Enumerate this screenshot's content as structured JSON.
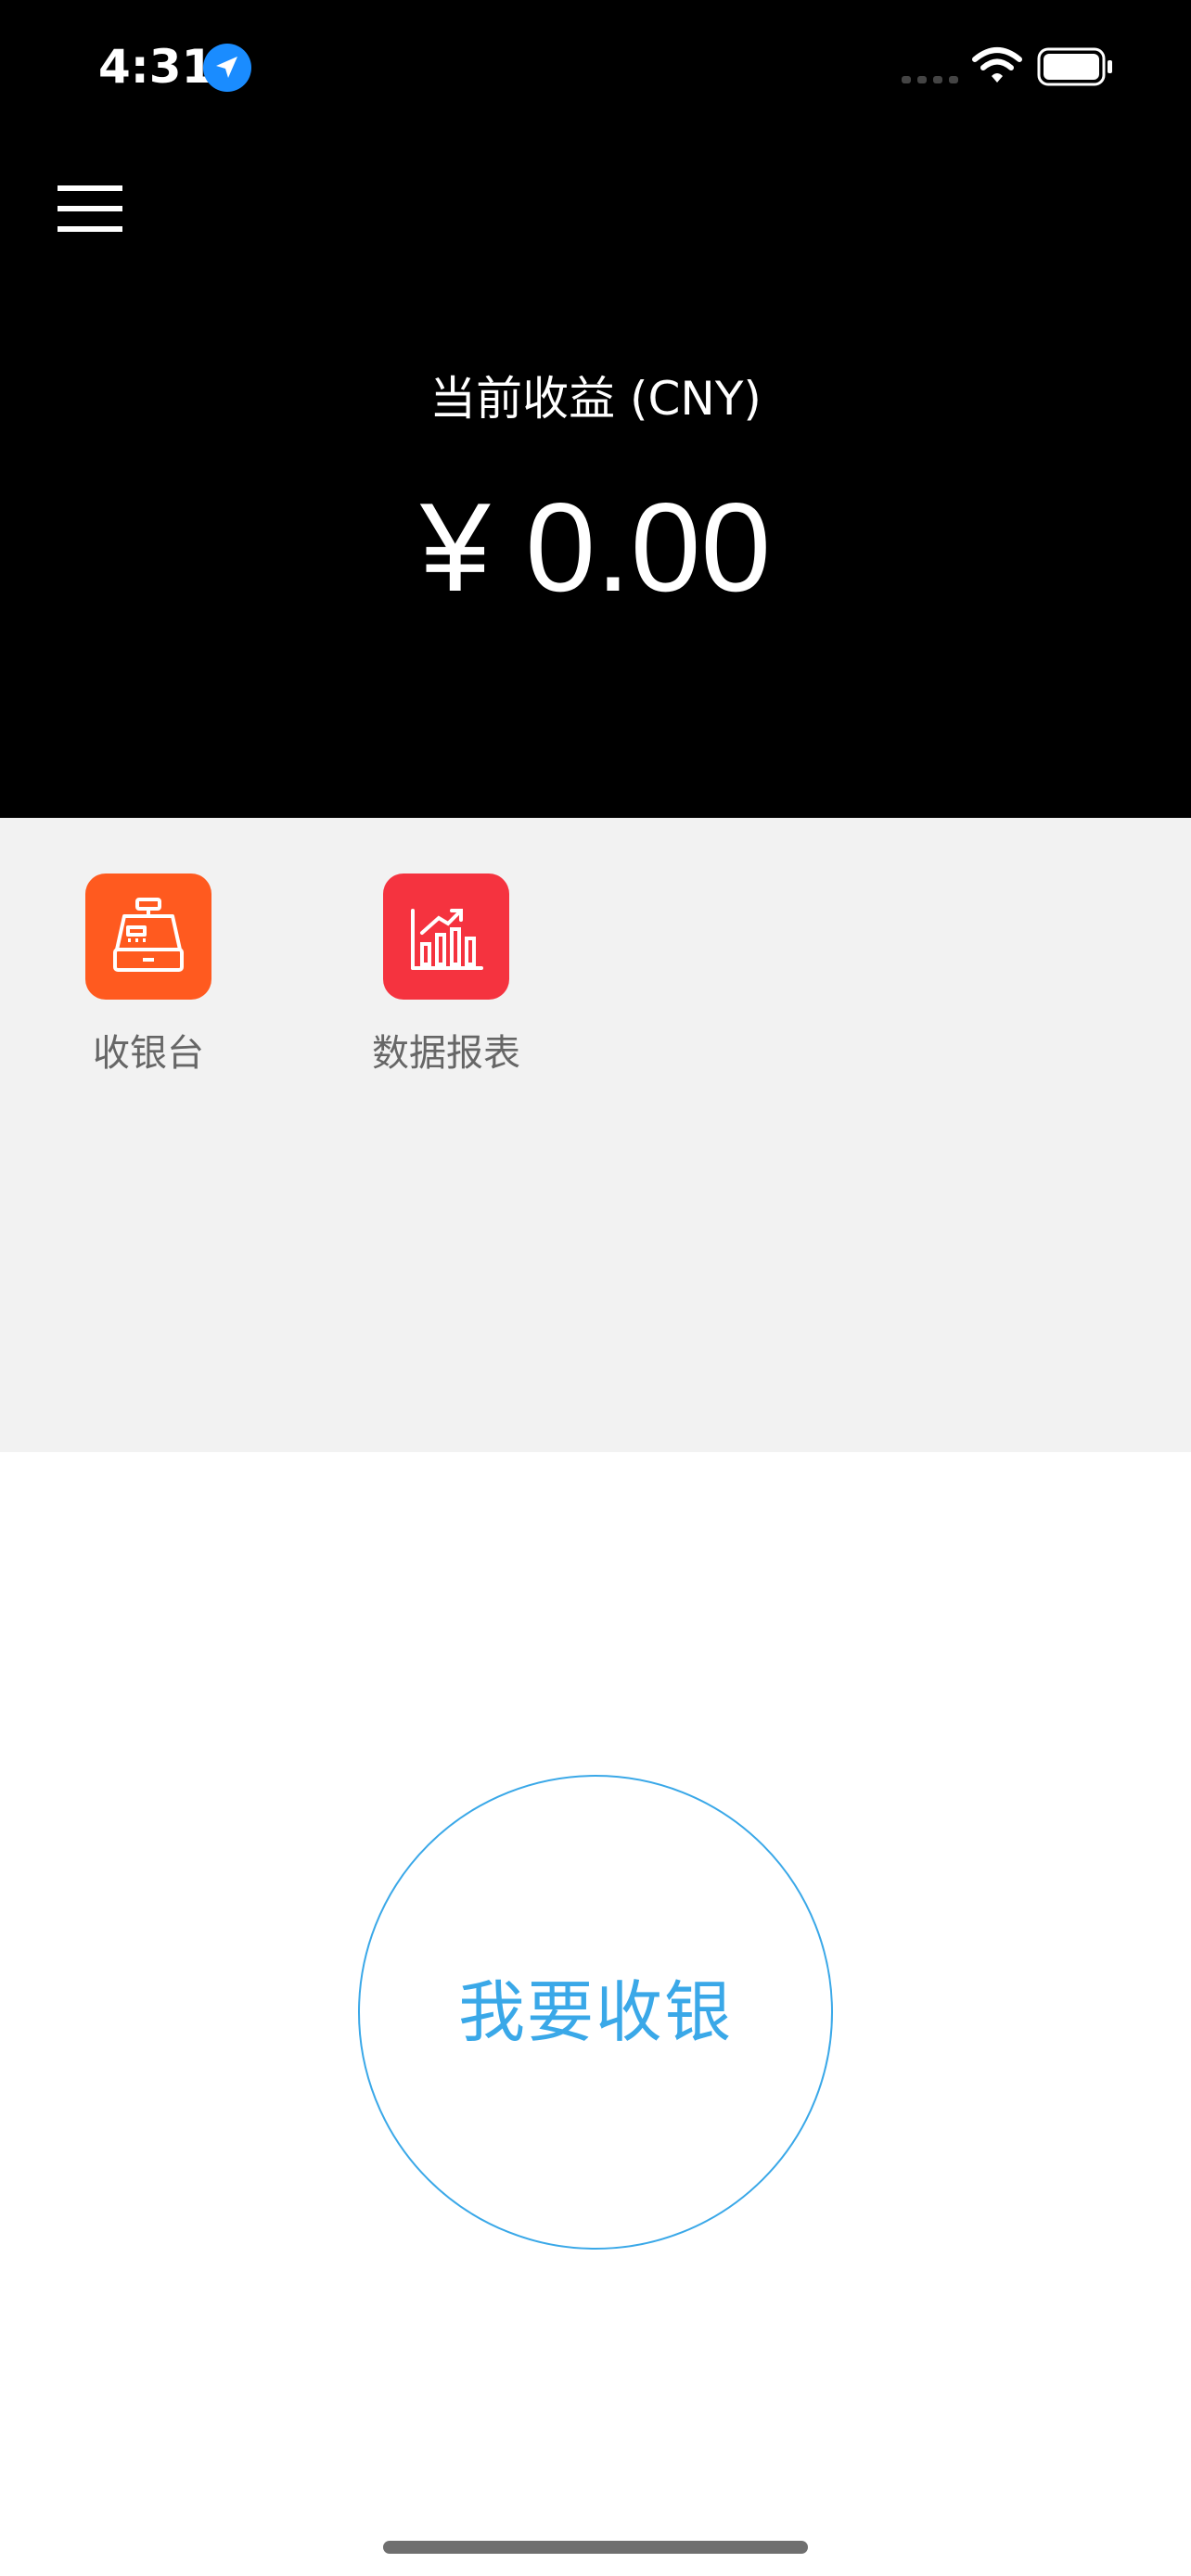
{
  "status_bar": {
    "time": "4:31",
    "icons": [
      "location-arrow-icon",
      "cellular-signal-icon",
      "wifi-icon",
      "battery-icon"
    ]
  },
  "header": {
    "menu_icon": "hamburger-menu-icon",
    "earnings_label": "当前收益 (CNY)",
    "earnings_amount": "¥ 0.00"
  },
  "shortcuts": [
    {
      "label": "收银台",
      "icon": "cash-register-icon",
      "color": "#ff5a1f"
    },
    {
      "label": "数据报表",
      "icon": "bar-chart-report-icon",
      "color": "#f5333f"
    }
  ],
  "cashier_button": {
    "label": "我要收银",
    "color": "#3aa8e8"
  },
  "colors": {
    "header_bg": "#000000",
    "grid_bg": "#f2f2f2",
    "page_bg": "#ffffff"
  }
}
